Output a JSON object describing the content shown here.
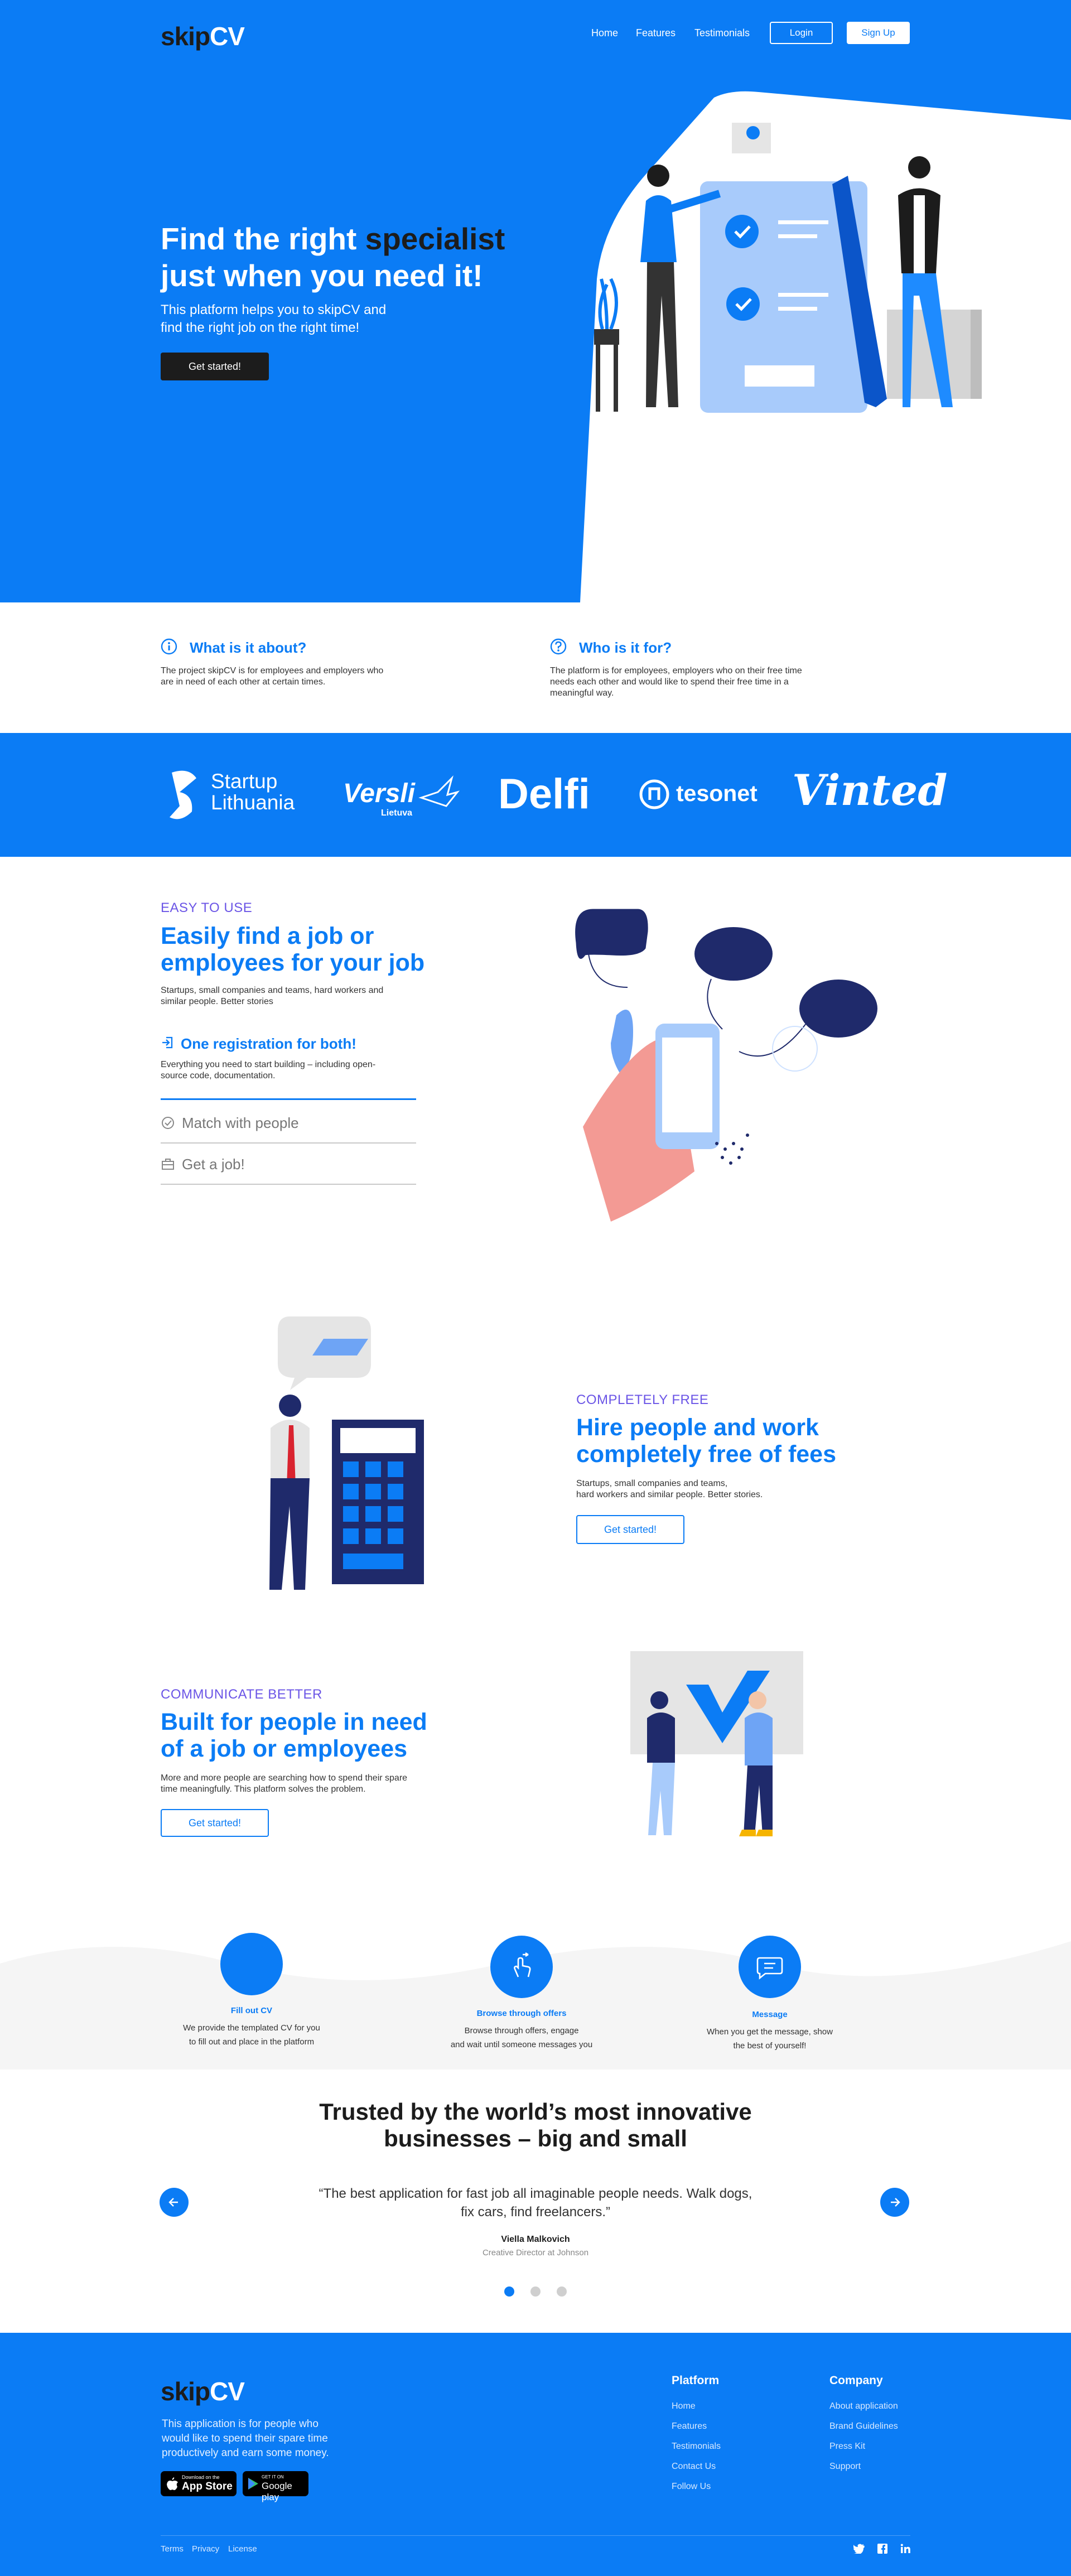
{
  "brand": {
    "part1": "skip",
    "part2": "CV"
  },
  "nav": {
    "items": [
      "Home",
      "Features",
      "Testimonials"
    ],
    "login": "Login",
    "signup": "Sign Up"
  },
  "hero": {
    "title_part1": "Find the right ",
    "title_highlight": "specialist",
    "title_line2": "just when you need it!",
    "subtitle_line1": "This platform helps you to skipCV and",
    "subtitle_line2": "find the right job on the right time!",
    "cta": "Get started!"
  },
  "about": [
    {
      "title": "What is it about?",
      "icon": "info-icon",
      "text_line1": "The project skipCV is for employees and employers who",
      "text_line2": "are in need of each other at certain times."
    },
    {
      "title": "Who is it for?",
      "icon": "question-icon",
      "text_line1": "The platform is for employees, employers who on their free time",
      "text_line2": "needs each other and would like to spend their free time in a",
      "text_line3": "meaningful way."
    }
  ],
  "partners": [
    "Startup",
    "Lithuania",
    "Versli",
    "Lietuva",
    "Delfi",
    "tesonet",
    "Vinted"
  ],
  "easy": {
    "kicker": "EASY TO USE",
    "title_line1": "Easily find a job or",
    "title_line2": "employees for your job",
    "text_line1": "Startups, small companies and teams, hard workers and",
    "text_line2": "similar people. Better stories",
    "active_feature": "One registration for both!",
    "active_text_line1": "Everything you need to start building – including open-",
    "active_text_line2": "source code, documentation.",
    "features": [
      "Match with people",
      "Get a job!"
    ]
  },
  "free": {
    "kicker": "COMPLETELY FREE",
    "title_line1": "Hire people and work",
    "title_line2": "completely free of fees",
    "text_line1": "Startups, small companies and teams,",
    "text_line2": "hard workers and similar people. Better stories.",
    "cta": "Get started!"
  },
  "communicate": {
    "kicker": "COMMUNICATE BETTER",
    "title_line1": "Built for people in need",
    "title_line2": "of a job or employees",
    "text_line1": "More and more people are searching how to spend their spare",
    "text_line2": "time meaningfully. This platform solves the problem.",
    "cta": "Get started!"
  },
  "steps": [
    {
      "title": "Fill out CV",
      "line1": "We provide the templated CV for you",
      "line2": "to fill out and place in the platform"
    },
    {
      "title": "Browse through offers",
      "line1": "Browse through offers, engage",
      "line2": "and wait until someone messages you"
    },
    {
      "title": "Message",
      "line1": "When you get the message, show",
      "line2": "the best of yourself!"
    }
  ],
  "testimonials": {
    "title_line1": "Trusted by the world’s most innovative",
    "title_line2": "businesses – big and small",
    "quote_line1": "“The best application for fast job all imaginable people needs. Walk dogs,",
    "quote_line2": "fix cars, find freelancers.”",
    "author": "Viella Malkovich",
    "role": "Creative Director at Johnson",
    "active_dot": 0,
    "dots": 3
  },
  "footer": {
    "text_line1": "This application is for people who",
    "text_line2": "would like to spend their spare time",
    "text_line3": "productively and earn some money.",
    "appstore_small": "Download on the",
    "appstore": "App Store",
    "googleplay_small": "GET IT ON",
    "googleplay": "Google play",
    "platform_title": "Platform",
    "platform_links": [
      "Home",
      "Features",
      "Testimonials",
      "Contact Us",
      "Follow Us"
    ],
    "company_title": "Company",
    "company_links": [
      "About application",
      "Brand Guidelines",
      "Press Kit",
      "Support"
    ],
    "bottom_links": [
      "Terms",
      "Privacy",
      "License"
    ],
    "social": [
      "twitter-icon",
      "facebook-icon",
      "linkedin-icon"
    ]
  },
  "colors": {
    "primary": "#0b7cf5",
    "navy": "#1f2a6b",
    "purple": "#6b55e6",
    "ink": "#1c1c1c"
  }
}
